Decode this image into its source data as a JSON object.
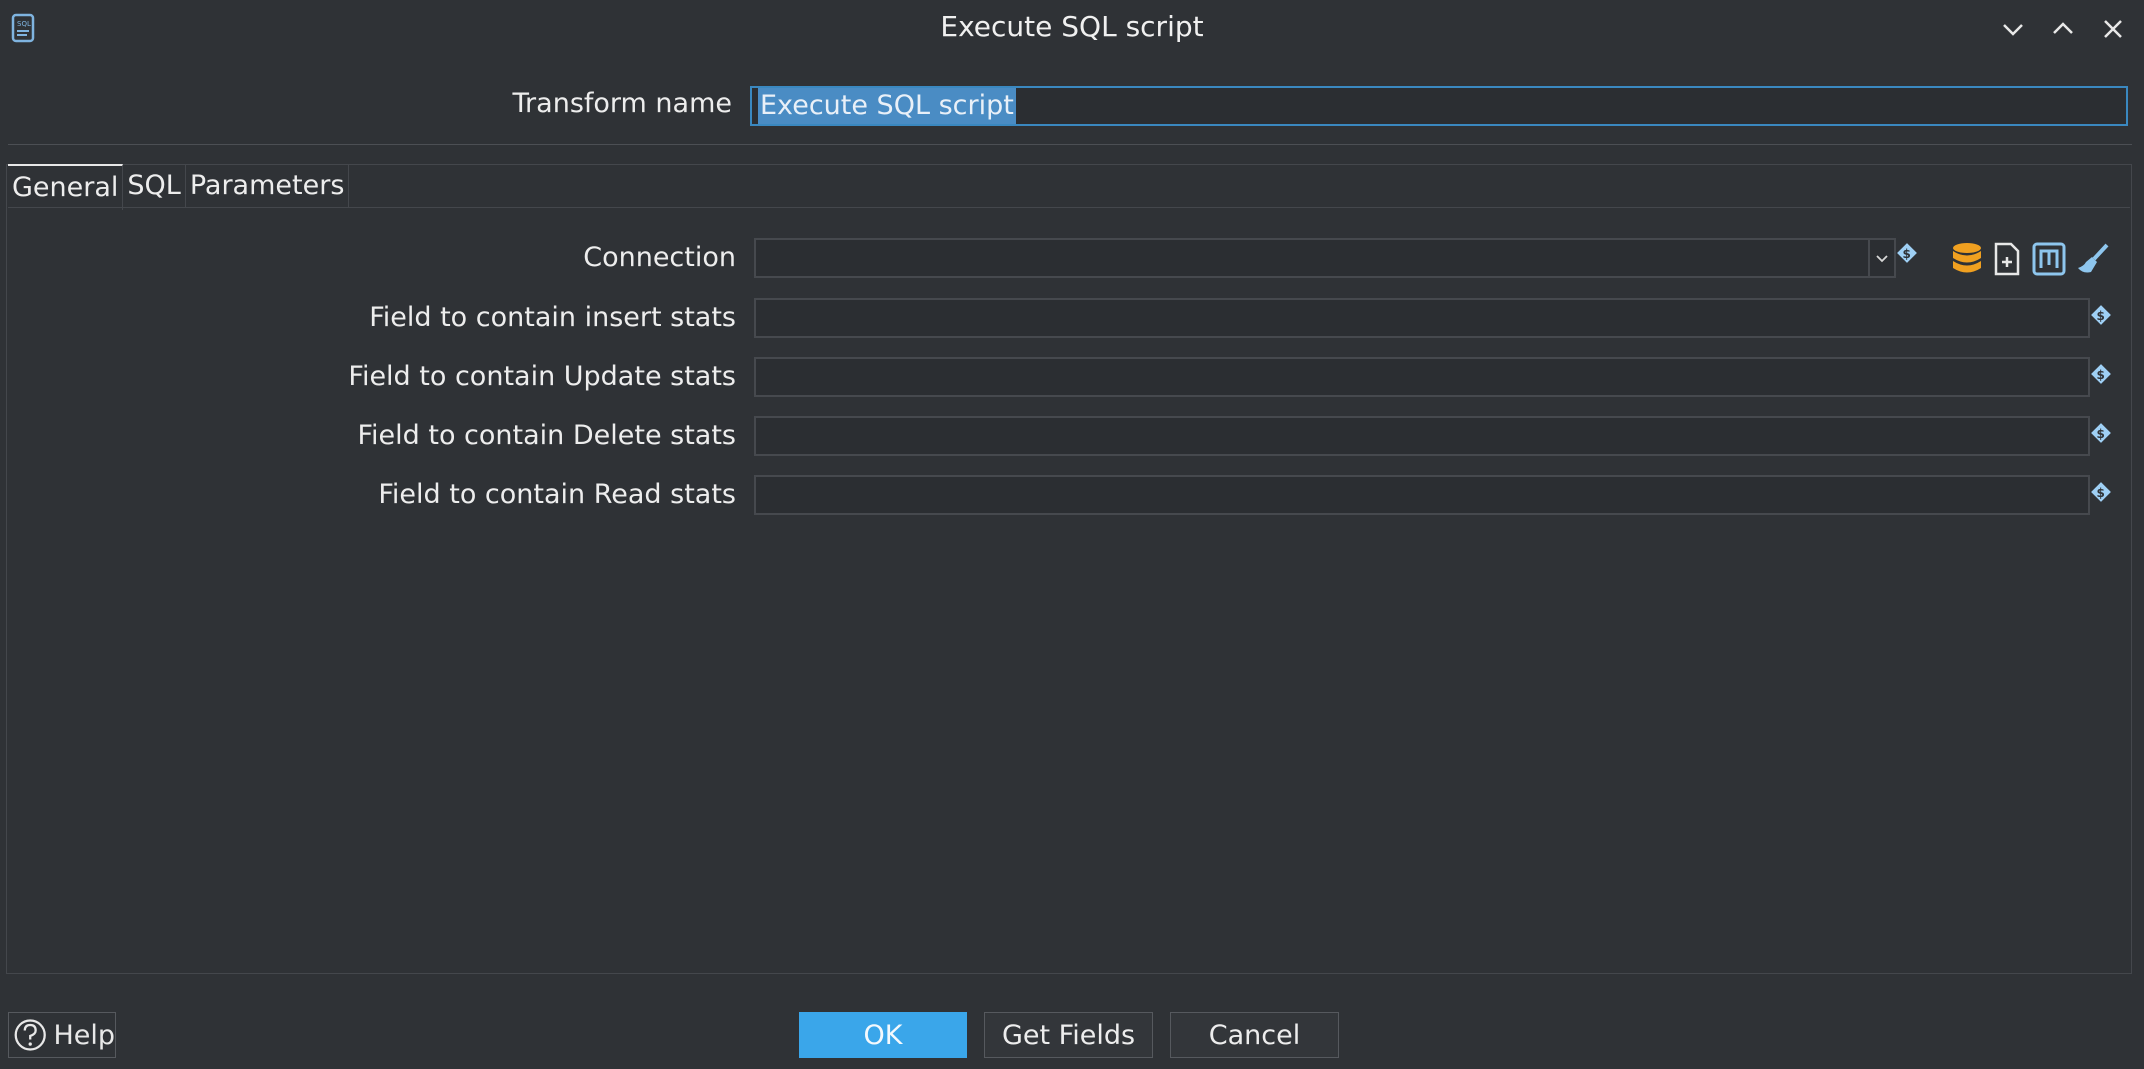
{
  "window": {
    "title": "Execute SQL script",
    "minimize_icon": "chevron-down-icon",
    "maximize_icon": "chevron-up-icon",
    "close_icon": "close-icon"
  },
  "transform": {
    "label": "Transform name",
    "value": "Execute SQL script"
  },
  "tabs": [
    {
      "label": "General",
      "active": true
    },
    {
      "label": "SQL",
      "active": false
    },
    {
      "label": "Parameters",
      "active": false
    }
  ],
  "general": {
    "connection_label": "Connection",
    "connection_value": "",
    "insert_label": "Field to contain insert stats",
    "insert_value": "",
    "update_label": "Field to contain Update stats",
    "update_value": "",
    "delete_label": "Field to contain Delete stats",
    "delete_value": "",
    "read_label": "Field to contain Read stats",
    "read_value": ""
  },
  "connection_tools": [
    "database-icon",
    "new-file-icon",
    "metadata-icon",
    "clean-brush-icon"
  ],
  "buttons": {
    "help": "Help",
    "ok": "OK",
    "get_fields": "Get Fields",
    "cancel": "Cancel"
  },
  "colors": {
    "accent": "#3aa6ea",
    "selection": "#4a8cc4",
    "database_icon": "#f0a020",
    "background": "#2f3236"
  }
}
